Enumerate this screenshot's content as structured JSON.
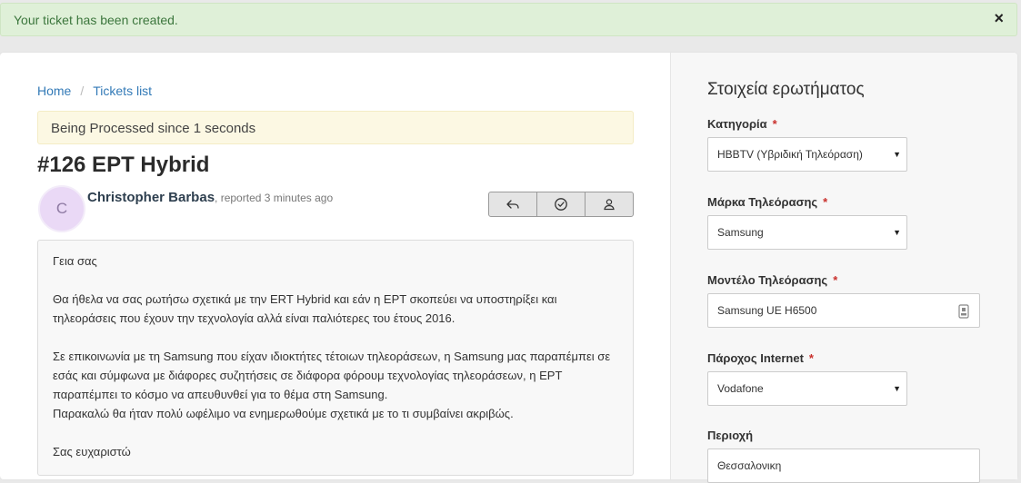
{
  "alert": {
    "text": "Your ticket has been created.",
    "close": "×"
  },
  "breadcrumb": {
    "home": "Home",
    "sep": "/",
    "tickets": "Tickets list"
  },
  "status": "Being Processed since 1 seconds",
  "ticket": {
    "title": "#126 ΕΡΤ Hybrid",
    "avatar_letter": "C",
    "author": "Christopher Barbas",
    "meta": ", reported 3 minutes ago"
  },
  "actions": {
    "reply_icon": "reply-icon",
    "resolve_icon": "check-circle-icon",
    "assign_icon": "user-icon"
  },
  "message": {
    "greeting": "Γεια σας",
    "p1_l1": "Θα ήθελα να σας ρωτήσω σχετικά με την ERT Hybrid και εάν η ΕΡΤ σκοπεύει να υποστηρίξει και",
    "p1_l2": "τηλεοράσεις που έχουν την τεχνολογία αλλά είναι παλιότερες του έτους 2016.",
    "p2_l1": "Σε επικοινωνία με τη Samsung που είχαν ιδιοκτήτες τέτοιων τηλεοράσεων, η Samsung μας παραπέμπει σε",
    "p2_l2": "εσάς και σύμφωνα με διάφορες συζητήσεις σε διάφορα φόρουμ τεχνολογίας τηλεοράσεων, η  ΕΡΤ",
    "p2_l3": "παραπέμπει το κόσμο να απευθυνθεί για το θέμα στη Samsung.",
    "p2_l4": "Παρακαλώ θα ήταν πολύ ωφέλιμο να ενημερωθούμε σχετικά με το τι συμβαίνει ακριβώς.",
    "thanks": "Σας ευχαριστώ"
  },
  "sidebar": {
    "title": "Στοιχεία ερωτήματος",
    "required_mark": "*",
    "category_label": "Κατηγορία",
    "category_value": "HBBTV (Υβριδική Τηλεόραση)",
    "brand_label": "Μάρκα Τηλεόρασης",
    "brand_value": "Samsung",
    "model_label": "Μοντέλο Τηλεόρασης",
    "model_value": "Samsung UE H6500",
    "isp_label": "Πάροχος Internet",
    "isp_value": "Vodafone",
    "region_label": "Περιοχή",
    "region_value": "Θεσσαλονικη"
  }
}
